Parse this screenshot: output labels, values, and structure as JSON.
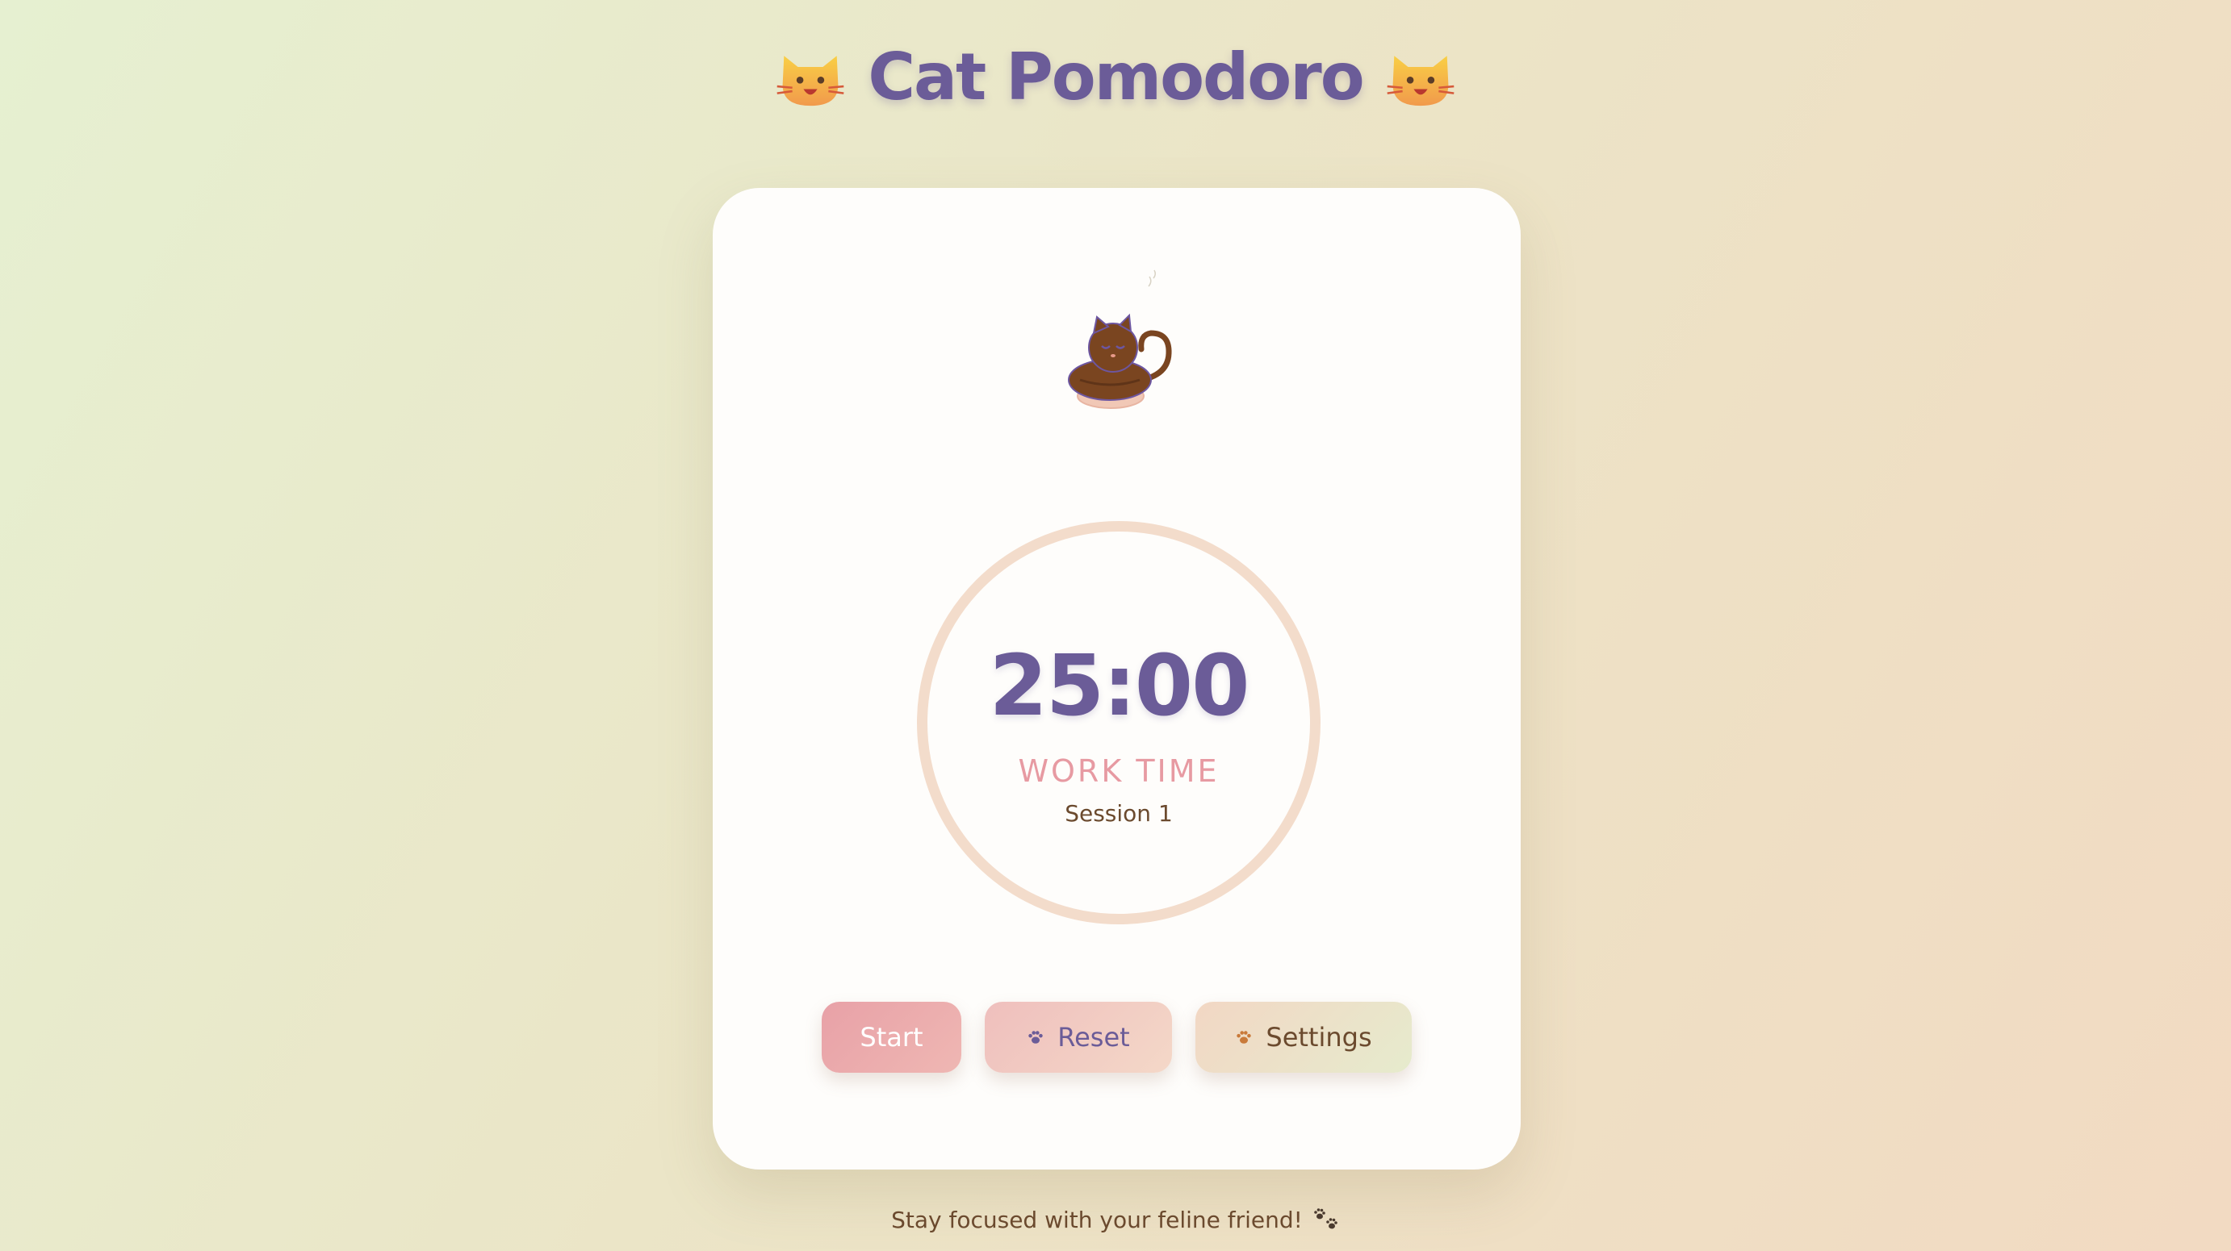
{
  "header": {
    "title": "Cat Pomodoro",
    "left_icon": "cat-face-icon",
    "right_icon": "cat-face-icon"
  },
  "timer": {
    "time": "25:00",
    "mode": "WORK TIME",
    "session": "Session 1",
    "progress": 0
  },
  "controls": {
    "start_label": "Start",
    "reset_label": "Reset",
    "reset_icon": "paw-icon",
    "settings_label": "Settings",
    "settings_icon": "paw-icon"
  },
  "footer": {
    "text": "Stay focused with your feline friend!",
    "icon": "paw-prints-icon"
  },
  "colors": {
    "primary_text": "#6b5c98",
    "accent_pink": "#e79aa2",
    "brown": "#6b4a2e",
    "ring": "#f3dccb"
  }
}
